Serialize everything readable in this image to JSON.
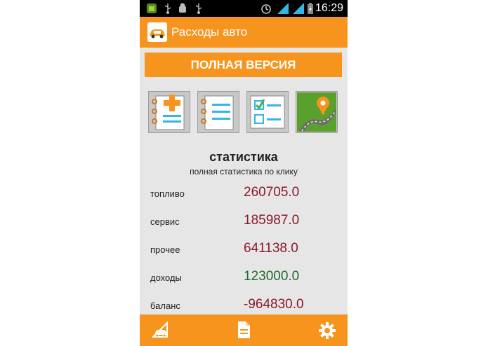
{
  "status_bar": {
    "time": "16:29"
  },
  "action_bar": {
    "title": "Расходы авто",
    "app_icon": "car-icon"
  },
  "banner": {
    "label": "ПОЛНАЯ ВЕРСИЯ"
  },
  "toolbar_tiles": [
    {
      "icon": "add-notebook-icon"
    },
    {
      "icon": "list-notebook-icon"
    },
    {
      "icon": "checklist-icon"
    },
    {
      "icon": "map-route-icon"
    }
  ],
  "stats": {
    "title": "статистика",
    "subtitle": "полная статистика по клику",
    "rows": [
      {
        "label": "топливо",
        "value": "260705.0"
      },
      {
        "label": "сервис",
        "value": "185987.0"
      },
      {
        "label": "прочее",
        "value": "641138.0"
      },
      {
        "label": "доходы",
        "value": "123000.0"
      },
      {
        "label": "баланс",
        "value": "-964830.0"
      }
    ]
  },
  "bottom_bar": {
    "icons": [
      "car-icon",
      "document-icon",
      "gear-icon"
    ]
  },
  "colors": {
    "accent": "#f7941d",
    "expense_value": "#8b1a2b",
    "income_value": "#1f6b2c",
    "background": "#e6e6e6"
  }
}
